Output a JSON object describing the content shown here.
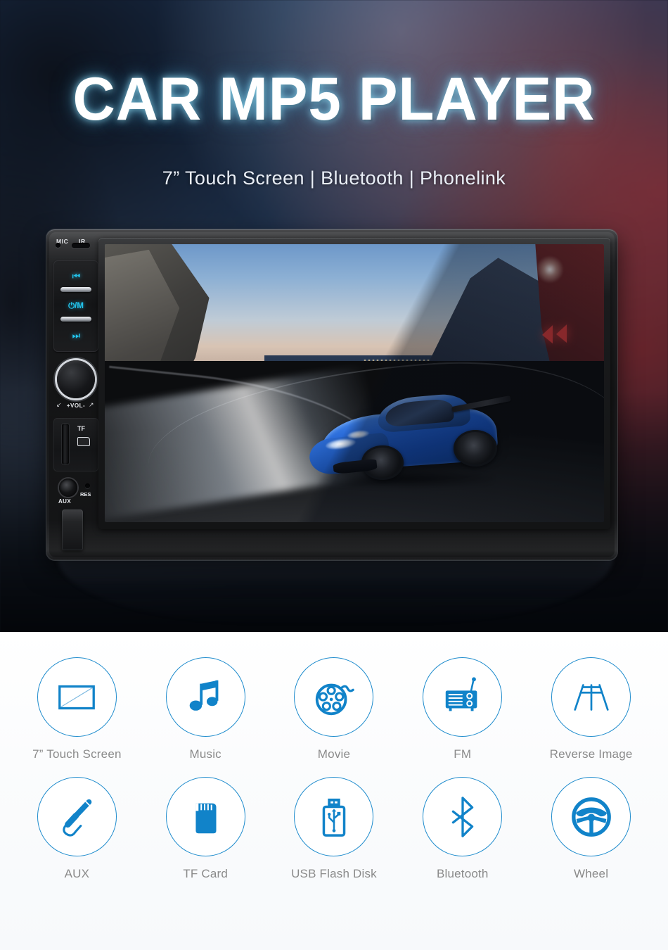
{
  "hero": {
    "title": "CAR MP5 PLAYER",
    "subtitle": "7” Touch Screen | Bluetooth | Phonelink"
  },
  "device": {
    "labels": {
      "mic": "MIC",
      "ir": "IR",
      "prev": "⏮",
      "power_mode": "⏻/M",
      "next": "⏭",
      "volume": "+VOL-",
      "vol_arrow_left": "↙",
      "vol_arrow_right": "↗",
      "tf": "TF",
      "aux": "AUX",
      "res": "RES"
    },
    "screen": {
      "scene": "blue sports car on mountain coastal road at dusk"
    }
  },
  "features": {
    "row1": [
      {
        "label": "7” Touch Screen",
        "icon": "touch-screen-icon"
      },
      {
        "label": "Music",
        "icon": "music-note-icon"
      },
      {
        "label": "Movie",
        "icon": "film-reel-icon"
      },
      {
        "label": "FM",
        "icon": "radio-icon"
      },
      {
        "label": "Reverse Image",
        "icon": "parking-guideline-icon"
      }
    ],
    "row2": [
      {
        "label": "AUX",
        "icon": "aux-jack-icon"
      },
      {
        "label": "TF Card",
        "icon": "sd-card-icon"
      },
      {
        "label": "USB Flash Disk",
        "icon": "usb-flash-drive-icon"
      },
      {
        "label": "Bluetooth",
        "icon": "bluetooth-icon"
      },
      {
        "label": "Wheel",
        "icon": "steering-wheel-icon"
      }
    ]
  },
  "colors": {
    "accent_blue": "#1f8ccd",
    "icon_blue": "#1183c9",
    "label_gray": "#8a8a8a",
    "button_cyan": "#23c6ef"
  }
}
